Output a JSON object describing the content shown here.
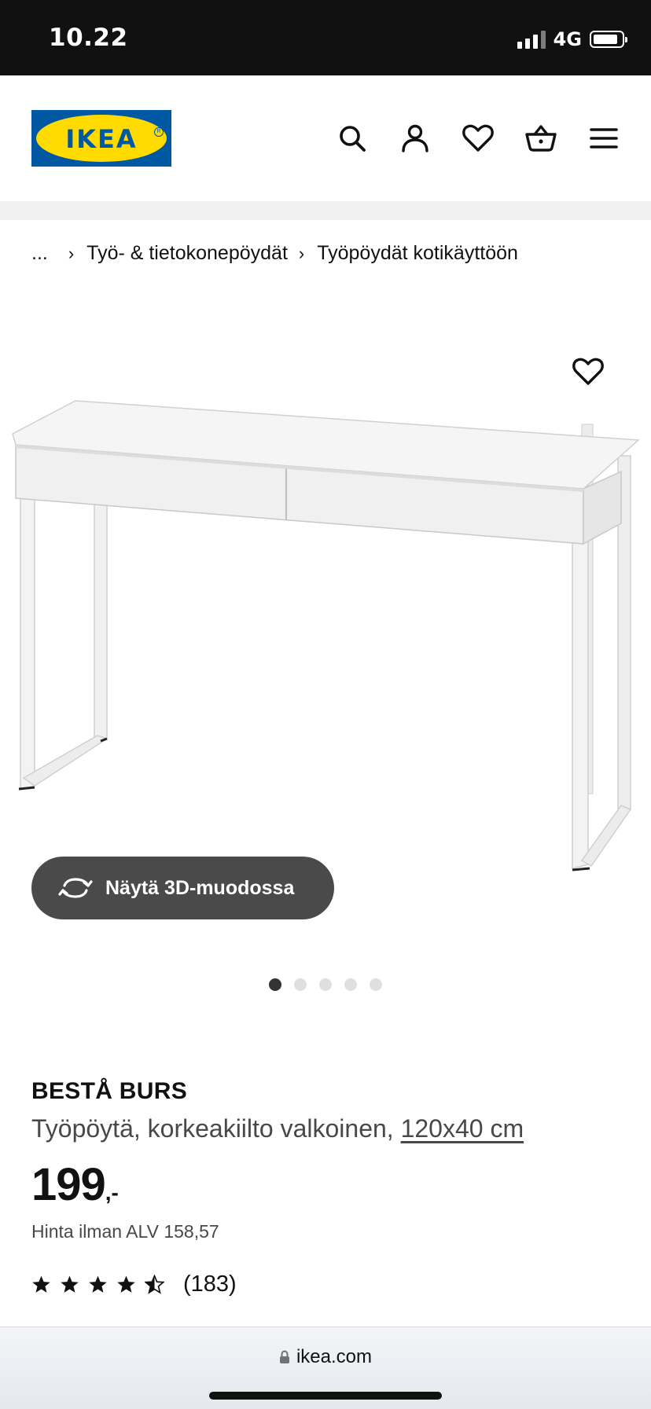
{
  "status_bar": {
    "time": "10.22",
    "network": "4G"
  },
  "header": {
    "logo_text": "IKEA",
    "icons": [
      "search-icon",
      "account-icon",
      "heart-icon",
      "basket-icon",
      "menu-icon"
    ]
  },
  "breadcrumb": {
    "ellipsis": "...",
    "items": [
      "Työ- & tietokonepöydät",
      "Työpöydät kotikäyttöön"
    ]
  },
  "gallery": {
    "view_3d_label": "Näytä 3D-muodossa",
    "image_count": 5,
    "active_index": 0
  },
  "product": {
    "name": "BESTÅ BURS",
    "description": "Työpöytä, korkeakiilto valkoinen,",
    "size": "120x40 cm",
    "price_integer": "199",
    "price_suffix": ",-",
    "vat_text": "Hinta ilman ALV 158,57",
    "rating_value": 4.5,
    "rating_max": 5,
    "review_count": "(183)"
  },
  "browser": {
    "url": "ikea.com"
  },
  "colors": {
    "ikea_blue": "#0058A3",
    "ikea_yellow": "#FFDB00",
    "button_dark": "#4a4a4a"
  }
}
